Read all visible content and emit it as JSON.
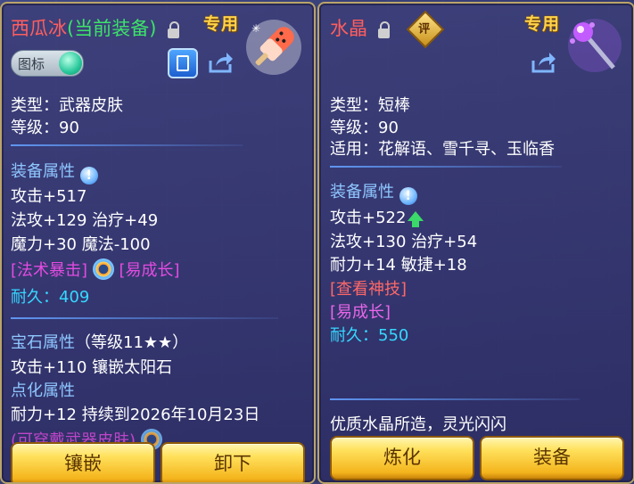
{
  "left": {
    "title_name": "西瓜冰",
    "title_status": "(当前装备)",
    "zhuanyong": "专用",
    "toggle_label": "图标",
    "type": "类型：武器皮肤",
    "level": "等级：90",
    "equip_attr_header": "装备属性",
    "attr1": "攻击+517",
    "attr2": "法攻+129 治疗+49",
    "attr3": "魔力+30 魔法-100",
    "special1": "[法术暴击]",
    "special2": "[易成长]",
    "durability_label": "耐久：",
    "durability_value": "409",
    "gem_header": "宝石属性",
    "gem_level": "（等级11★★）",
    "gem_detail": "攻击+110 镶嵌太阳石",
    "dianhua_header": "点化属性",
    "dianhua_detail": "耐力+12 持续到2026年10月23日",
    "cutoff_text": "(可穿戴武器皮肤)",
    "btn_inlay": "镶嵌",
    "btn_unequip": "卸下"
  },
  "right": {
    "title_name": "水晶",
    "ping": "评",
    "zhuanyong": "专用",
    "type": "类型：短棒",
    "level": "等级：90",
    "usable": "适用：花解语、雪千寻、玉临香",
    "equip_attr_header": "装备属性",
    "attr1": "攻击+522",
    "attr2": "法攻+130 治疗+54",
    "attr3": "耐力+14 敏捷+18",
    "view_skill": "[查看神技]",
    "special": "[易成长]",
    "durability_label": "耐久：",
    "durability_value": "550",
    "description": "优质水晶所造，灵光闪闪",
    "btn_refine": "炼化",
    "btn_equip": "装备"
  }
}
